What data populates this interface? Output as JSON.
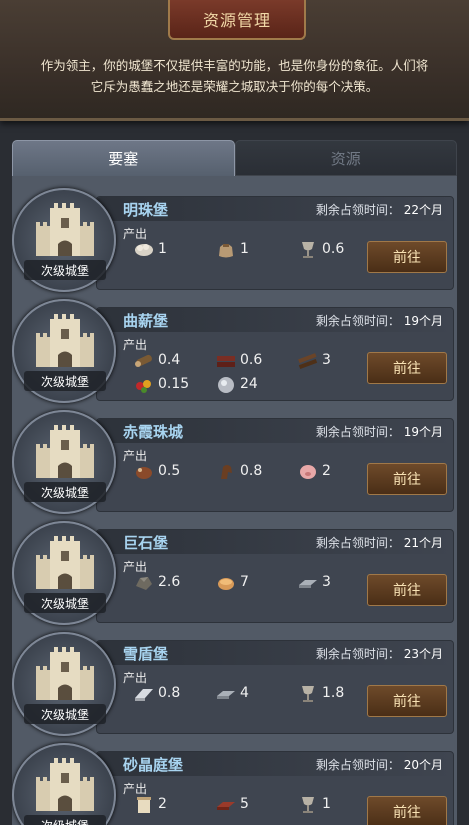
{
  "header": {
    "title": "资源管理",
    "intro_line1": "作为领主，你的城堡不仅提供丰富的功能，也是你身份的象征。人们将",
    "intro_line2": "它斥为愚蠢之地还是荣耀之城取决于你的每个决策。"
  },
  "tabs": [
    {
      "label": "要塞",
      "active": true
    },
    {
      "label": "资源",
      "active": false
    }
  ],
  "labels": {
    "produce": "产出",
    "remaining": "剩余占领时间：",
    "go": "前往"
  },
  "castles": [
    {
      "name": "明珠堡",
      "rank": "次级城堡",
      "remaining_value": "22",
      "remaining_unit": "个月",
      "resources": [
        {
          "icon": "wool-icon",
          "value": "1"
        },
        {
          "icon": "sack-icon",
          "value": "1"
        },
        {
          "icon": "goblet-icon",
          "value": "0.6"
        }
      ]
    },
    {
      "name": "曲薪堡",
      "rank": "次级城堡",
      "remaining_value": "19",
      "remaining_unit": "个月",
      "resources": [
        {
          "icon": "log-icon",
          "value": "0.4"
        },
        {
          "icon": "plank-icon",
          "value": "0.6"
        },
        {
          "icon": "timber-icon",
          "value": "3"
        },
        {
          "icon": "fruit-icon",
          "value": "0.15"
        },
        {
          "icon": "silver-orb-icon",
          "value": "24"
        }
      ]
    },
    {
      "name": "赤霞珠城",
      "rank": "次级城堡",
      "remaining_value": "19",
      "remaining_unit": "个月",
      "resources": [
        {
          "icon": "cow-icon",
          "value": "0.5"
        },
        {
          "icon": "horse-icon",
          "value": "0.8"
        },
        {
          "icon": "pig-icon",
          "value": "2"
        }
      ]
    },
    {
      "name": "巨石堡",
      "rank": "次级城堡",
      "remaining_value": "21",
      "remaining_unit": "个月",
      "resources": [
        {
          "icon": "ore-icon",
          "value": "2.6"
        },
        {
          "icon": "bread-icon",
          "value": "7"
        },
        {
          "icon": "iron-bar-icon",
          "value": "3"
        }
      ]
    },
    {
      "name": "雪盾堡",
      "rank": "次级城堡",
      "remaining_value": "23",
      "remaining_unit": "个月",
      "resources": [
        {
          "icon": "silver-bar-icon",
          "value": "0.8"
        },
        {
          "icon": "iron-bar-icon",
          "value": "4"
        },
        {
          "icon": "goblet-icon",
          "value": "1.8"
        }
      ]
    },
    {
      "name": "砂晶庭堡",
      "rank": "次级城堡",
      "remaining_value": "20",
      "remaining_unit": "个月",
      "resources": [
        {
          "icon": "scroll-icon",
          "value": "2"
        },
        {
          "icon": "brick-icon",
          "value": "5"
        },
        {
          "icon": "goblet-icon",
          "value": "1"
        }
      ]
    }
  ]
}
